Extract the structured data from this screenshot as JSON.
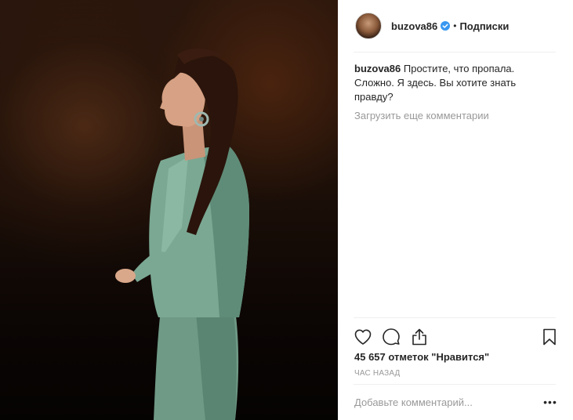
{
  "post": {
    "photo_icon": "portrait-photo",
    "author": "buzova86",
    "verified_icon": "verified-badge-icon",
    "separator": "•",
    "follow_label": "Подписки"
  },
  "caption": {
    "author": "buzova86",
    "text": "Простите, что пропала. Сложно. Я здесь. Вы хотите знать правду?"
  },
  "load_more_label": "Загрузить еще комментарии",
  "actions": {
    "like_icon": "heart-icon",
    "comment_icon": "comment-icon",
    "share_icon": "share-icon",
    "save_icon": "bookmark-icon"
  },
  "likes_text": "45 657 отметок \"Нравится\"",
  "time_text": "ЧАС НАЗАД",
  "add_comment_placeholder": "Добавьте комментарий...",
  "more_label": "•••",
  "colors": {
    "accent_blue": "#3897f0",
    "text": "#262626",
    "muted": "#999999",
    "divider": "#efefef"
  }
}
